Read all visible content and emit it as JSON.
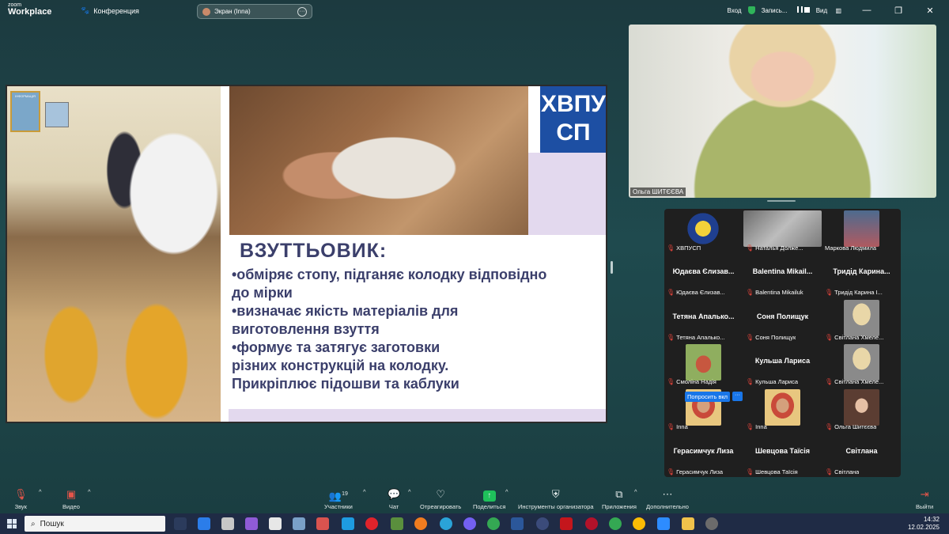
{
  "app": {
    "logo_small": "zoom",
    "logo_big": "Workplace",
    "conference_label": "Конференция",
    "share_label": "Экран (Inna)",
    "share_more": "···"
  },
  "topbar": {
    "login": "Вход",
    "recording": "Запись...",
    "view": "Вид",
    "minimize": "—",
    "restore": "❐",
    "close": "✕"
  },
  "slide": {
    "emblem_line1": "ХВПУ",
    "emblem_line2": "СП",
    "poster_text": "ІНФОРМАЦІЯ",
    "title": "ВЗУТТЬОВИК:",
    "line1": "•обміряє стопу, підганяє колодку відповідно",
    "line2": " до мірки",
    "line3": "•визначає якість матеріалів для",
    "line4": "виготовлення взуття",
    "line5": "•формує та затягує заготовки",
    "line6": "різних конструкцій на колодку.",
    "line7": "Прикріплює підошви та каблуки"
  },
  "speaker": {
    "name": "Ольга ШИТЄЄВА"
  },
  "gallery": {
    "ask_button": "Попросить вкл",
    "ask_more": "···",
    "tiles": [
      {
        "display": "",
        "label": "ХВПУСП"
      },
      {
        "display": "",
        "label": "Наталья Долже..."
      },
      {
        "display": "",
        "label": "Маркова Людмила"
      },
      {
        "display": "Юдаєва Єлизав...",
        "label": "Юдаєва Єлизав..."
      },
      {
        "display": "Balentina  Mikail...",
        "label": "Balentina Mikailuk"
      },
      {
        "display": "Тридід  Карина...",
        "label": "Тридід Карина І..."
      },
      {
        "display": "Тетяна  Апалько...",
        "label": "Тетяна Апалько..."
      },
      {
        "display": "Соня Полищук",
        "label": "Соня Полищук"
      },
      {
        "display": "",
        "label": "Світлана Хмеле..."
      },
      {
        "display": "",
        "label": "Смоліна Надія"
      },
      {
        "display": "Кульша Лариса",
        "label": "Кульша Лариса"
      },
      {
        "display": "",
        "label": "Світлана Хмеле..."
      },
      {
        "display": "",
        "label": "Inna"
      },
      {
        "display": "",
        "label": "Inna"
      },
      {
        "display": "",
        "label": "Ольга Шитєєва"
      },
      {
        "display": "Герасимчук Лиза",
        "label": "Герасимчук Лиза"
      },
      {
        "display": "Шевцова Таїсія",
        "label": "Шевцова Таїсія"
      },
      {
        "display": "Світлана",
        "label": "Світлана"
      }
    ]
  },
  "toolbar": {
    "audio": "Звук",
    "video": "Видео",
    "participants": "Участники",
    "participants_count": "19",
    "chat": "Чат",
    "react": "Отреагировать",
    "share": "Поделиться",
    "host_tools": "Инструменты организатора",
    "apps": "Приложения",
    "more": "Дополнительно",
    "leave": "Выйти"
  },
  "taskbar": {
    "search": "Пошук",
    "time": "14:32",
    "date": "12.02.2025"
  },
  "colors": {
    "background": "#1f4a4e",
    "slide_text": "#3b3f6b",
    "emblem": "#1d4fa3",
    "share_green": "#1fc15b",
    "mute_red": "#e0433a"
  }
}
